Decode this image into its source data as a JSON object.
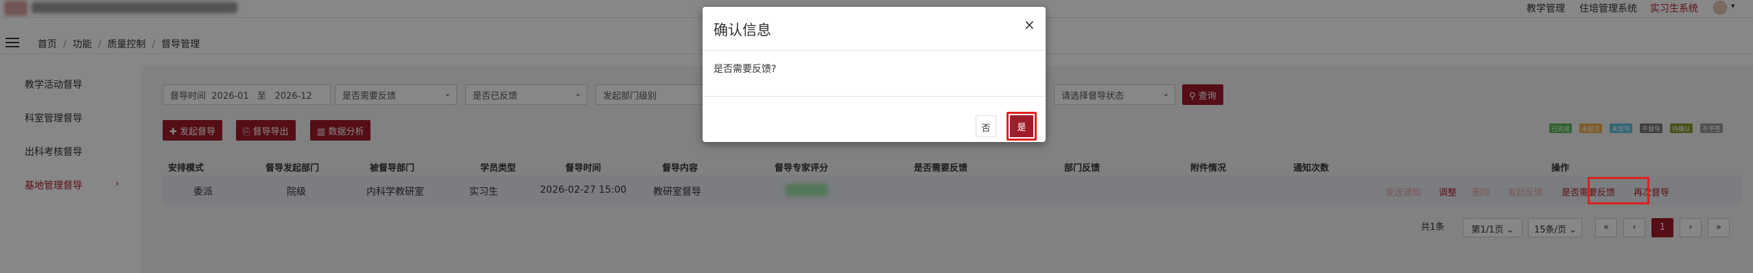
{
  "topnav": {
    "items": [
      "教学管理",
      "住培管理系统",
      "实习生系统"
    ],
    "caret": "▾"
  },
  "breadcrumb": {
    "items": [
      "首页",
      "功能",
      "质量控制",
      "督导管理"
    ],
    "sep": "/"
  },
  "sidebar": {
    "items": [
      "教学活动督导",
      "科室管理督导",
      "出科考核督导",
      "基地管理督导"
    ],
    "arrow": "›"
  },
  "filters": {
    "time_label": "督导时间",
    "time_start": "2026-01",
    "time_to": "至",
    "time_end": "2026-12",
    "need_feedback": "是否需要反馈",
    "has_feedback": "是否已反馈",
    "dept_level": "发起部门级别",
    "status": "请选择督导状态",
    "search": "查询"
  },
  "actions": {
    "start": "发起督导",
    "export": "督导导出",
    "analysis": "数据分析"
  },
  "legend": [
    {
      "label": "已完成",
      "color": "#5cb85c"
    },
    {
      "label": "未提交",
      "color": "#f0ad4e"
    },
    {
      "label": "未督导",
      "color": "#5bc0de"
    },
    {
      "label": "不督导",
      "color": "#777777"
    },
    {
      "label": "待确认",
      "color": "#8a9a2a"
    },
    {
      "label": "不予签",
      "color": "#9a9a9a"
    }
  ],
  "table": {
    "headers": [
      "安排模式",
      "督导发起部门",
      "被督导部门",
      "学员类型",
      "督导时间",
      "督导内容",
      "督导专家评分",
      "是否需要反馈",
      "部门反馈",
      "附件情况",
      "通知次数",
      "操作"
    ],
    "row": [
      "委派",
      "院级",
      "内科学教研室",
      "实习生",
      "2026-02-27 15:00",
      "教研室督导"
    ],
    "ops": [
      "发送通知",
      "调整",
      "删除",
      "发起反馈",
      "是否需要反馈",
      "再次督导"
    ]
  },
  "pagination": {
    "total": "共1条",
    "page_select": "第1/1页",
    "per_page": "15条/页",
    "first": "«",
    "prev": "‹",
    "current": "1",
    "next": "›",
    "last": "»"
  },
  "modal": {
    "title": "确认信息",
    "close": "×",
    "message": "是否需要反馈?",
    "no": "否",
    "yes": "是"
  },
  "colors": {
    "accent": "#a01c2a",
    "highlight": "#e0201c"
  }
}
